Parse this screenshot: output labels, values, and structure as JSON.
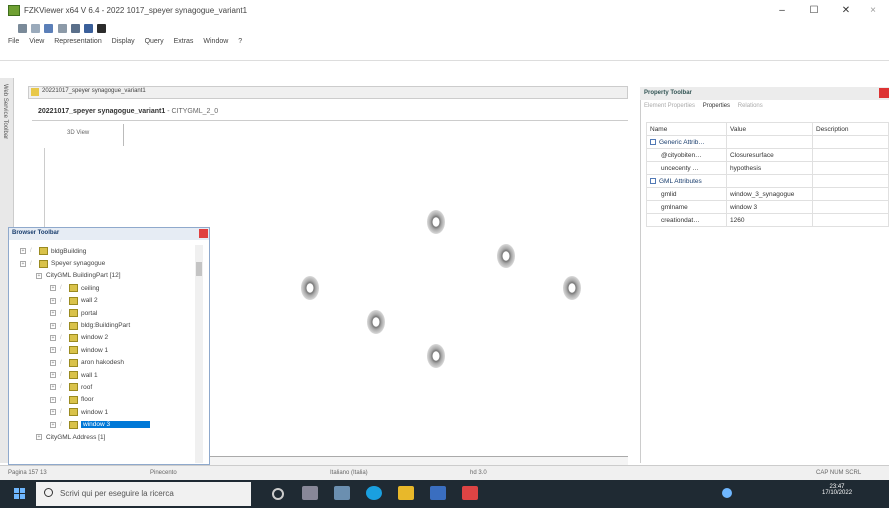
{
  "window": {
    "title": "FZKViewer x64 V 6.4 - 2022 1017_speyer synagogue_variant1",
    "minimize": "–",
    "maximize": "☐",
    "close": "✕",
    "outer_close": "×"
  },
  "menu": [
    "File",
    "View",
    "Representation",
    "Display",
    "Query",
    "Extras",
    "Window",
    "?"
  ],
  "side_toolbar": {
    "label": "Web Service Toolbar"
  },
  "viewer": {
    "tab_label": "20221017_speyer synagogue_variant1",
    "model_title": "20221017_speyer synagogue_variant1",
    "model_suffix": " - CITYGML_2_0",
    "view_tab": "3D View"
  },
  "properties": {
    "title": "Property Toolbar",
    "tabs": [
      "Element Properties",
      "Properties",
      "Relations"
    ],
    "active_tab": 1,
    "columns": [
      "Name",
      "Value",
      "Description"
    ],
    "rows": [
      {
        "group": true,
        "name": "Generic Attrib…",
        "value": "",
        "desc": ""
      },
      {
        "group": false,
        "name": "@cityobiten…",
        "value": "Closuresurface",
        "desc": ""
      },
      {
        "group": false,
        "name": "uncecenty …",
        "value": "hypothesis",
        "desc": ""
      },
      {
        "group": true,
        "name": "GML Attributes",
        "value": "",
        "desc": ""
      },
      {
        "group": false,
        "name": "gmlid",
        "value": "window_3_synagogue",
        "desc": ""
      },
      {
        "group": false,
        "name": "gmlname",
        "value": "window 3",
        "desc": ""
      },
      {
        "group": false,
        "name": "creationdat…",
        "value": "1260",
        "desc": ""
      }
    ]
  },
  "browser": {
    "title": "Browser Toolbar",
    "items": [
      {
        "label": "bldgBuilding",
        "level": 1,
        "folder": true,
        "selected": false
      },
      {
        "label": "Speyer synagogue",
        "level": 1,
        "folder": true,
        "selected": false
      },
      {
        "label": "CityGML BuildingPart [12]",
        "level": 2,
        "folder": false,
        "selected": false
      },
      {
        "label": "ceiling",
        "level": 3,
        "folder": true,
        "selected": false
      },
      {
        "label": "wall 2",
        "level": 3,
        "folder": true,
        "selected": false
      },
      {
        "label": "portal",
        "level": 3,
        "folder": true,
        "selected": false
      },
      {
        "label": "bldg:BuildingPart",
        "level": 3,
        "folder": true,
        "selected": false
      },
      {
        "label": "window 2",
        "level": 3,
        "folder": true,
        "selected": false
      },
      {
        "label": "window 1",
        "level": 3,
        "folder": true,
        "selected": false
      },
      {
        "label": "aron hakodesh",
        "level": 3,
        "folder": true,
        "selected": false
      },
      {
        "label": "wall 1",
        "level": 3,
        "folder": true,
        "selected": false
      },
      {
        "label": "roof",
        "level": 3,
        "folder": true,
        "selected": false
      },
      {
        "label": "floor",
        "level": 3,
        "folder": true,
        "selected": false
      },
      {
        "label": "window 1",
        "level": 3,
        "folder": true,
        "selected": false
      },
      {
        "label": "window 3",
        "level": 3,
        "folder": true,
        "selected": true
      },
      {
        "label": "CityGML Address [1]",
        "level": 2,
        "folder": false,
        "selected": false
      }
    ]
  },
  "status": {
    "left": "Pagina 157 13",
    "middle": "Pinecento",
    "center": "Italiano (Italia)",
    "extra": "hd   3.0",
    "right": "CAP  NUM  SCRL"
  },
  "taskbar": {
    "search_placeholder": "Scrivi qui per eseguire la ricerca",
    "time": "23:47",
    "date": "17/10/2022"
  },
  "colors": {
    "selection": "#0078d7",
    "folder": "#d9c24a",
    "taskbar": "#1f2a33"
  }
}
